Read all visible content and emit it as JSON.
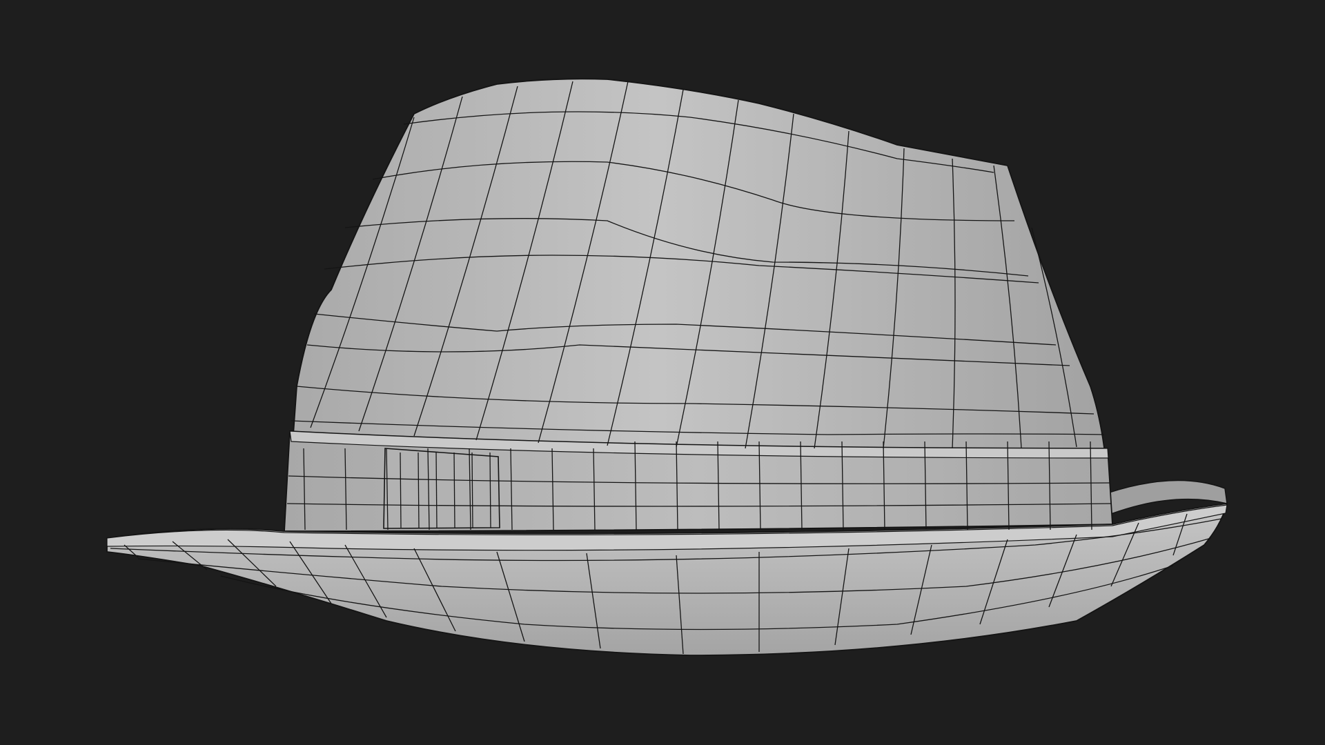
{
  "scene": {
    "subject": "fedora-hat-wireframe",
    "background_color": "#1e1e1e",
    "surface_color": "#b8b8b8",
    "wire_color": "#141414"
  }
}
